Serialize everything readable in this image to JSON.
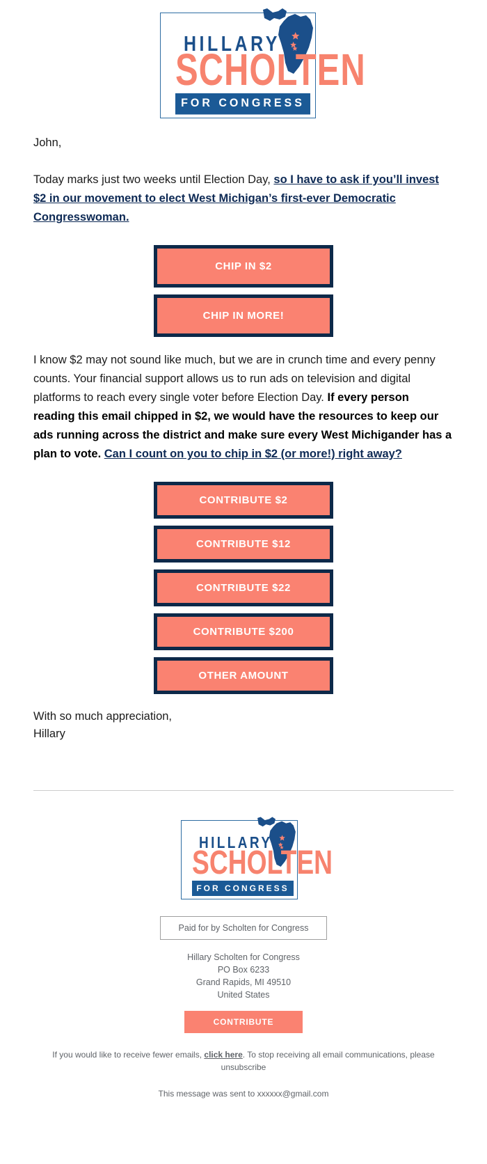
{
  "logo": {
    "name_first": "HILLARY",
    "name_last": "SCHOLTEN",
    "tagline": "FOR CONGRESS",
    "map_icon": "michigan-map-icon",
    "colors": {
      "navy": "#0d2949",
      "blue": "#1b5a96",
      "salmon": "#fa8271"
    }
  },
  "message": {
    "greeting": "John,",
    "para1_plain": "Today marks just two weeks until Election Day, ",
    "para1_link": "so I have to ask if you’ll invest $2 in our movement to elect West Michigan’s first-ever Democratic Congresswoman.",
    "para2_plain_1": "I know $2 may not sound like much, but we are in crunch time and every penny counts. Your financial support allows us to run ads on television and digital platforms to reach every single voter before Election Day. ",
    "para2_bold": "If every person reading this email chipped in $2, we would have the resources to keep our ads running across the district and make sure every West Michigander has a plan to vote. ",
    "para2_link": "Can I count on you to chip in $2 (or more!) right away?",
    "signoff_line1": "With so much appreciation,",
    "signoff_line2": "Hillary"
  },
  "cta_group_1": [
    {
      "label": "CHIP IN $2"
    },
    {
      "label": "CHIP IN MORE!"
    }
  ],
  "cta_group_2": [
    {
      "label": "CONTRIBUTE $2"
    },
    {
      "label": "CONTRIBUTE $12"
    },
    {
      "label": "CONTRIBUTE $22"
    },
    {
      "label": "CONTRIBUTE $200"
    },
    {
      "label": "OTHER AMOUNT"
    }
  ],
  "footer": {
    "paid_for": "Paid for by Scholten for Congress",
    "address_line1": "Hillary Scholten for Congress",
    "address_line2": "PO Box 6233",
    "address_line3": "Grand Rapids, MI 49510",
    "address_line4": "United States",
    "contribute_label": "CONTRIBUTE",
    "fine_print_before": "If you would like to receive fewer emails, ",
    "fine_print_link": "click here",
    "fine_print_after": ". To stop receiving all email communications, please unsubscribe",
    "sent_to": "This message was sent to xxxxxx@gmail.com"
  }
}
